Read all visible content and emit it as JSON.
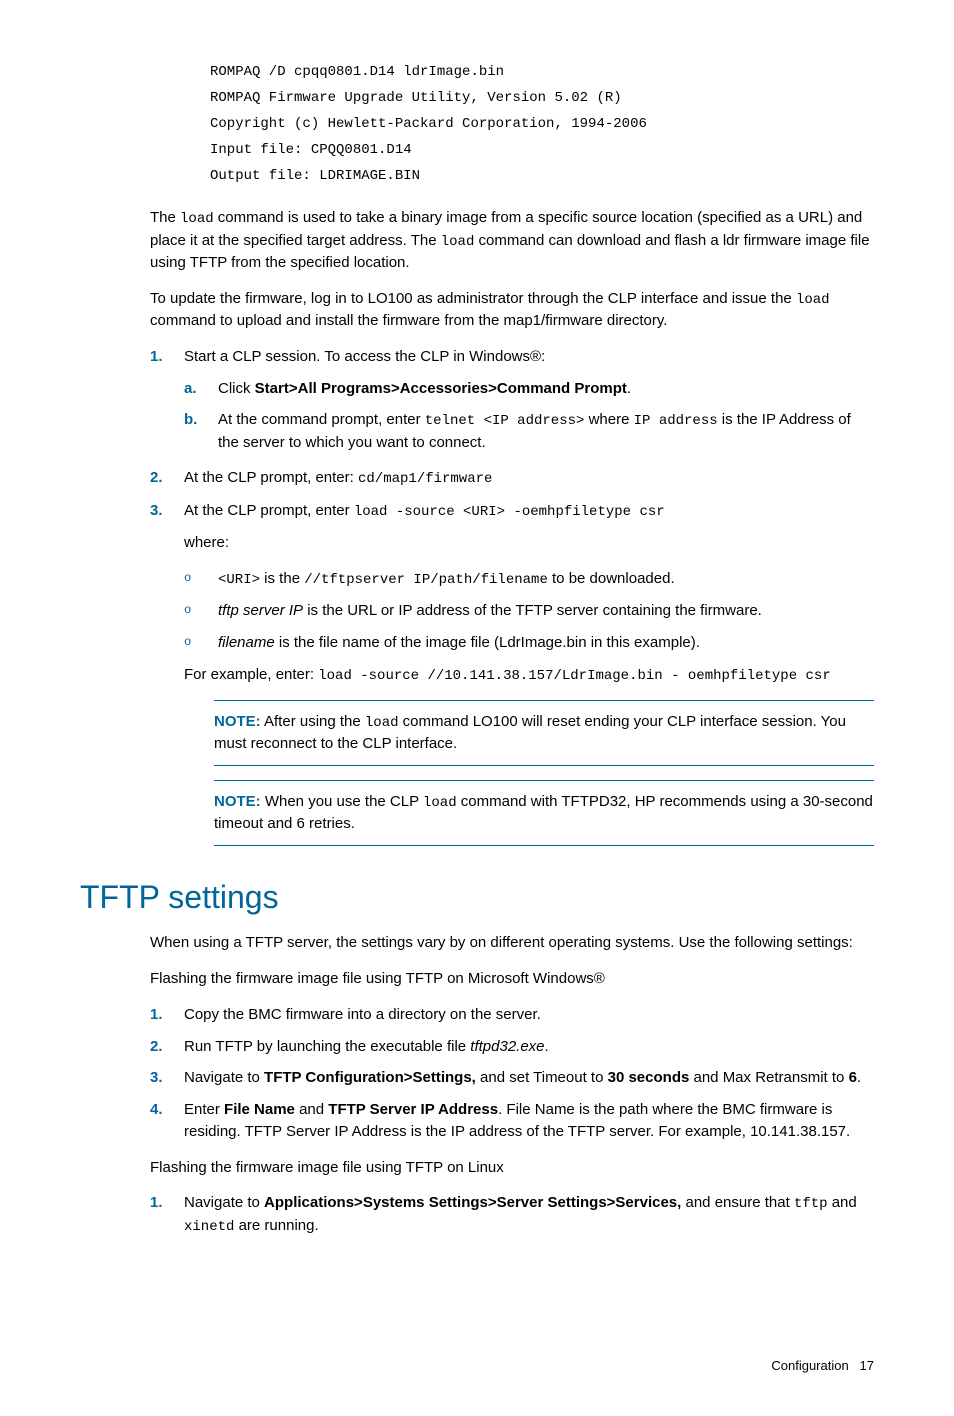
{
  "code_block": [
    "ROMPAQ /D cpqq0801.D14 ldrImage.bin",
    "ROMPAQ Firmware Upgrade Utility, Version 5.02 (R)",
    "Copyright (c) Hewlett-Packard Corporation, 1994-2006",
    "Input file:   CPQQ0801.D14",
    "Output file:  LDRIMAGE.BIN"
  ],
  "para1": {
    "pre1": "The ",
    "code1": "load",
    "mid1": " command is used to take a binary image from a specific source location (specified as a URL) and place it at the specified target address. The ",
    "code2": "load",
    "post1": " command can download and flash a ldr firmware image file using TFTP from the specified location."
  },
  "para2": {
    "pre": "To update the firmware, log in to LO100 as administrator through the CLP interface and issue the ",
    "code": "load",
    "post": " command to upload and install the firmware from the map1/firmware directory."
  },
  "step1": {
    "num": "1.",
    "text": "Start a CLP session. To access the CLP in Windows®:",
    "a": {
      "num": "a.",
      "pre": "Click ",
      "bold": "Start>All Programs>Accessories>Command Prompt",
      "post": "."
    },
    "b": {
      "num": "b.",
      "pre": "At the command prompt, enter ",
      "code1": "telnet <IP address>",
      "mid": " where ",
      "code2": "IP address",
      "post": " is the IP Address of the server to which you want to connect."
    }
  },
  "step2": {
    "num": "2.",
    "pre": "At the CLP prompt, enter: ",
    "code": "cd/map1/firmware"
  },
  "step3": {
    "num": "3.",
    "pre": "At the CLP prompt, enter ",
    "code": "load -source <URI> -oemhpfiletype csr",
    "where": "where:",
    "u1": {
      "code1": "<URI>",
      "mid": " is the ",
      "code2": "//tftpserver IP/path/filename",
      "post": " to be downloaded."
    },
    "u2": {
      "it": "tftp server IP",
      "post": " is the URL or IP address of the TFTP server containing the firmware."
    },
    "u3": {
      "it": "filename",
      "post": " is the file name of the image file (LdrImage.bin in this example)."
    },
    "example_pre": "For example, enter: ",
    "example_code": "load -source //10.141.38.157/LdrImage.bin - oemhpfiletype csr"
  },
  "note1": {
    "label": "NOTE:",
    "pre": "  After using the ",
    "code": "load",
    "post": " command LO100 will reset ending your CLP interface session. You must reconnect to the CLP interface."
  },
  "note2": {
    "label": "NOTE:",
    "pre": "  When you use the CLP ",
    "code": "load",
    "post": " command with TFTPD32, HP recommends using a 30-second timeout and 6 retries."
  },
  "h2": "TFTP settings",
  "tftp_p1": "When using a TFTP server, the settings vary by on different operating systems. Use the following settings:",
  "tftp_p2": "Flashing the firmware image file using TFTP on Microsoft Windows®",
  "t1": {
    "num": "1.",
    "text": "Copy the BMC firmware into a directory on the server."
  },
  "t2": {
    "num": "2.",
    "pre": "Run TFTP by launching the executable file ",
    "it": "tftpd32.exe",
    "post": "."
  },
  "t3": {
    "num": "3.",
    "pre": "Navigate to ",
    "b1": "TFTP Configuration>Settings,",
    "mid1": " and set Timeout to ",
    "b2": "30 seconds",
    "mid2": " and Max Retransmit to ",
    "b3": "6",
    "post": "."
  },
  "t4": {
    "num": "4.",
    "pre": "Enter ",
    "b1": "File Name",
    "mid1": " and ",
    "b2": "TFTP Server IP Address",
    "post": ". File Name is the path where the BMC firmware is residing. TFTP Server IP Address is the IP address of the TFTP server. For example, 10.141.38.157."
  },
  "tftp_p3": "Flashing the firmware image file using TFTP on Linux",
  "l1": {
    "num": "1.",
    "pre": "Navigate to ",
    "b": "Applications>Systems Settings>Server Settings>Services,",
    "mid": " and ensure that ",
    "c1": "tftp",
    "mid2": " and ",
    "c2": "xinetd",
    "post": " are running."
  },
  "footer": {
    "label": "Configuration",
    "page": "17"
  }
}
